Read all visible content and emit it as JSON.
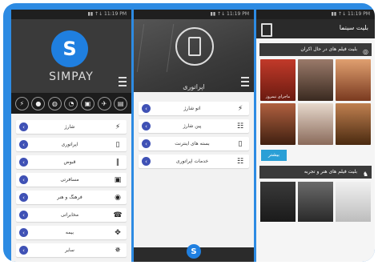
{
  "panel1": {
    "status": "▮▮ ↑↓ 11:19 PM",
    "brand": "SIMPAY",
    "logo_letter": "S",
    "quick_icons": [
      "bolt",
      "user",
      "globe",
      "chat",
      "bus",
      "plane",
      "bill",
      "more"
    ],
    "menu": [
      {
        "label": "شارژ",
        "icon": "bolt-icon",
        "glyph": "⚡"
      },
      {
        "label": "اپراتوری",
        "icon": "phone-icon",
        "glyph": "▯"
      },
      {
        "label": "قبوض",
        "icon": "barcode-icon",
        "glyph": "‖"
      },
      {
        "label": "مسافرتی",
        "icon": "luggage-icon",
        "glyph": "▣"
      },
      {
        "label": "فرهنگ و هنر",
        "icon": "theater-icon",
        "glyph": "◉"
      },
      {
        "label": "مخابراتی",
        "icon": "telephone-icon",
        "glyph": "☎"
      },
      {
        "label": "بیمه",
        "icon": "insurance-icon",
        "glyph": "✥"
      },
      {
        "label": "سایر",
        "icon": "other-icon",
        "glyph": "✵"
      }
    ]
  },
  "panel2": {
    "status": "▮▮ ↑↓ 11:19 PM",
    "title": "اپراتوری",
    "menu": [
      {
        "label": "اتو شارژ",
        "icon": "bolt-icon",
        "glyph": "⚡"
      },
      {
        "label": "پین شارژ",
        "icon": "keypad-icon",
        "glyph": "☷"
      },
      {
        "label": "بسته های اینترنت",
        "icon": "phone-wifi-icon",
        "glyph": "▯"
      },
      {
        "label": "خدمات اپراتوری",
        "icon": "dial-icon",
        "glyph": "☷"
      }
    ],
    "bottom_logo": "S"
  },
  "panel3": {
    "status": "▮▮ ↑↓ 11:19 PM",
    "title": "بلیت سینما",
    "section1": "بلیت فیلم های در حال اکران",
    "section2": "بلیت فیلم های هنر و تجربه",
    "view_button": "بیشتر",
    "posters": [
      {
        "caption": "ماجرای نیمروز",
        "color": "#8a2a1a"
      },
      {
        "caption": "",
        "color": "#6a4a3a"
      },
      {
        "caption": "",
        "color": "#c97b4a"
      },
      {
        "caption": "",
        "color": "#5a3a2a"
      },
      {
        "caption": "",
        "color": "#b89a8a"
      },
      {
        "caption": "",
        "color": "#7a5a3a"
      }
    ],
    "posters2": [
      {
        "caption": "",
        "color": "#3a3a3a"
      },
      {
        "caption": "",
        "color": "#555555"
      },
      {
        "caption": "",
        "color": "#d8d8d8"
      }
    ]
  }
}
